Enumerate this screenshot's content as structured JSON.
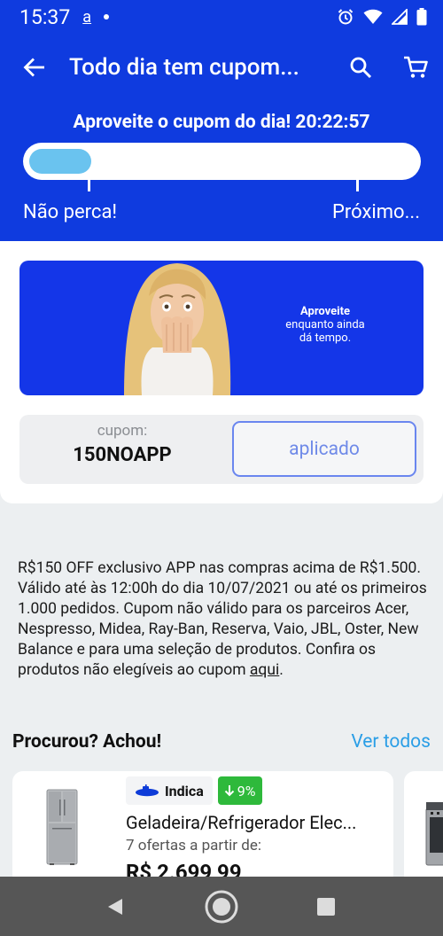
{
  "status_bar": {
    "time": "15:37",
    "notification_glyph": "a"
  },
  "app_bar": {
    "title": "Todo dia tem cupom..."
  },
  "timer": {
    "headline": "Aproveite o cupom do dia! 20:22:57",
    "progress_fraction": 0.16,
    "left_label": "Não perca!",
    "right_label": "Próximo..."
  },
  "banner": {
    "line1": "Aproveite",
    "line2": "enquanto ainda",
    "line3": "dá tempo."
  },
  "coupon": {
    "label": "cupom:",
    "code": "150NOAPP",
    "button_label": "aplicado"
  },
  "terms": {
    "text": "R$150 OFF exclusivo APP nas compras acima de R$1.500. Válido até às 12:00h do dia 10/07/2021 ou até os primeiros 1.000 pedidos.  Cupom não válido para os parceiros Acer, Nespresso, Midea, Ray-Ban, Reserva, Vaio, JBL, Oster, New Balance e para uma seleção de produtos. Confira os produtos não elegíveis ao cupom ",
    "link": "aqui",
    "end": "."
  },
  "section": {
    "title": "Procurou? Achou!",
    "link": "Ver todos"
  },
  "products": [
    {
      "badge_brand": "Indica",
      "badge_discount": "9%",
      "name": "Geladeira/Refrigerador Elec...",
      "offers": "7 ofertas a partir de:",
      "price": "R$ 2.699,99"
    }
  ],
  "colors": {
    "primary": "#0f3bdf",
    "progress": "#6ac3ef",
    "link": "#2b9ee6",
    "discount": "#2eb93b"
  }
}
